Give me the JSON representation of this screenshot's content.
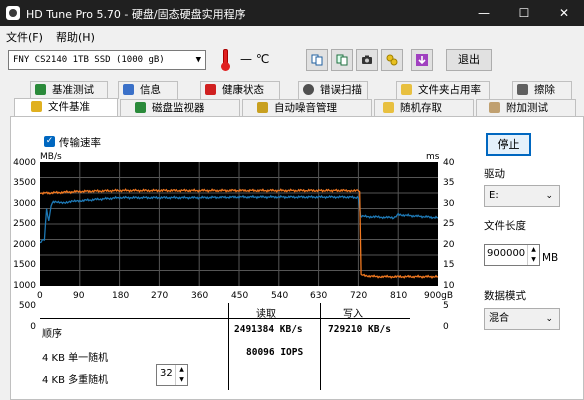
{
  "window": {
    "title": "HD Tune Pro 5.70 - 硬盘/固态硬盘实用程序",
    "minimize": "—",
    "maximize": "☐",
    "close": "✕"
  },
  "menu": {
    "file": "文件(F)",
    "help": "帮助(H)"
  },
  "toolbar": {
    "drive": "FNY CS2140 1TB SSD (1000 gB)",
    "temperature": "— ℃",
    "exit": "退出"
  },
  "tabs_row1": [
    "基准测试",
    "信息",
    "健康状态",
    "错误扫描",
    "文件夹占用率",
    "擦除"
  ],
  "tabs_row2": [
    "文件基准",
    "磁盘监视器",
    "自动噪音管理",
    "随机存取",
    "附加测试"
  ],
  "options": {
    "transfer_rate_label": "传输速率",
    "transfer_rate_checked": true
  },
  "chart_data": {
    "type": "line",
    "left_unit": "MB/s",
    "right_unit": "ms",
    "left_ticks": [
      "4000",
      "3500",
      "3000",
      "2500",
      "2000",
      "1500",
      "1000",
      "500",
      "0"
    ],
    "right_ticks": [
      "40",
      "35",
      "30",
      "25",
      "20",
      "15",
      "10",
      "5",
      "0"
    ],
    "x_ticks": [
      "0",
      "90",
      "180",
      "270",
      "360",
      "450",
      "540",
      "630",
      "720",
      "810",
      "900gB"
    ],
    "x_range": [
      0,
      900
    ],
    "left_range": [
      0,
      4000
    ],
    "right_range": [
      0,
      40
    ],
    "grid": true,
    "series": [
      {
        "axis": "left",
        "color": "#1e78b4",
        "x": [
          0,
          10,
          15,
          20,
          25,
          30,
          60,
          90,
          180,
          270,
          360,
          450,
          540,
          630,
          700,
          720,
          725,
          800,
          810,
          900
        ],
        "y": [
          1400,
          1500,
          2500,
          2100,
          2600,
          2700,
          2700,
          2750,
          2850,
          2850,
          2850,
          2870,
          2870,
          2870,
          2870,
          2850,
          2250,
          2200,
          2300,
          2200
        ]
      },
      {
        "axis": "right",
        "color": "#f07820",
        "x": [
          0,
          20,
          90,
          180,
          270,
          360,
          450,
          540,
          630,
          690,
          720,
          723,
          726,
          760,
          810,
          900
        ],
        "y": [
          30,
          30,
          30.5,
          30.8,
          30.8,
          30.8,
          30.8,
          30.8,
          30.8,
          30.8,
          30.8,
          30.5,
          3.5,
          3,
          3,
          3
        ]
      }
    ]
  },
  "results": {
    "read_header": "读取",
    "write_header": "写入",
    "rows": [
      {
        "label": "顺序",
        "read": "2491384 KB/s",
        "write": "729210 KB/s"
      },
      {
        "label": "4 KB 单一随机",
        "read": "80096 IOPS",
        "write": ""
      },
      {
        "label": "4 KB 多重随机",
        "read": "",
        "write": ""
      }
    ],
    "queue_depth": "32"
  },
  "right_panel": {
    "stop_button": "停止",
    "drive_label": "驱动",
    "drive_value": "E:",
    "file_length_label": "文件长度",
    "file_length_value": "900000",
    "file_length_unit": "MB",
    "data_mode_label": "数据模式",
    "data_mode_value": "混合"
  }
}
